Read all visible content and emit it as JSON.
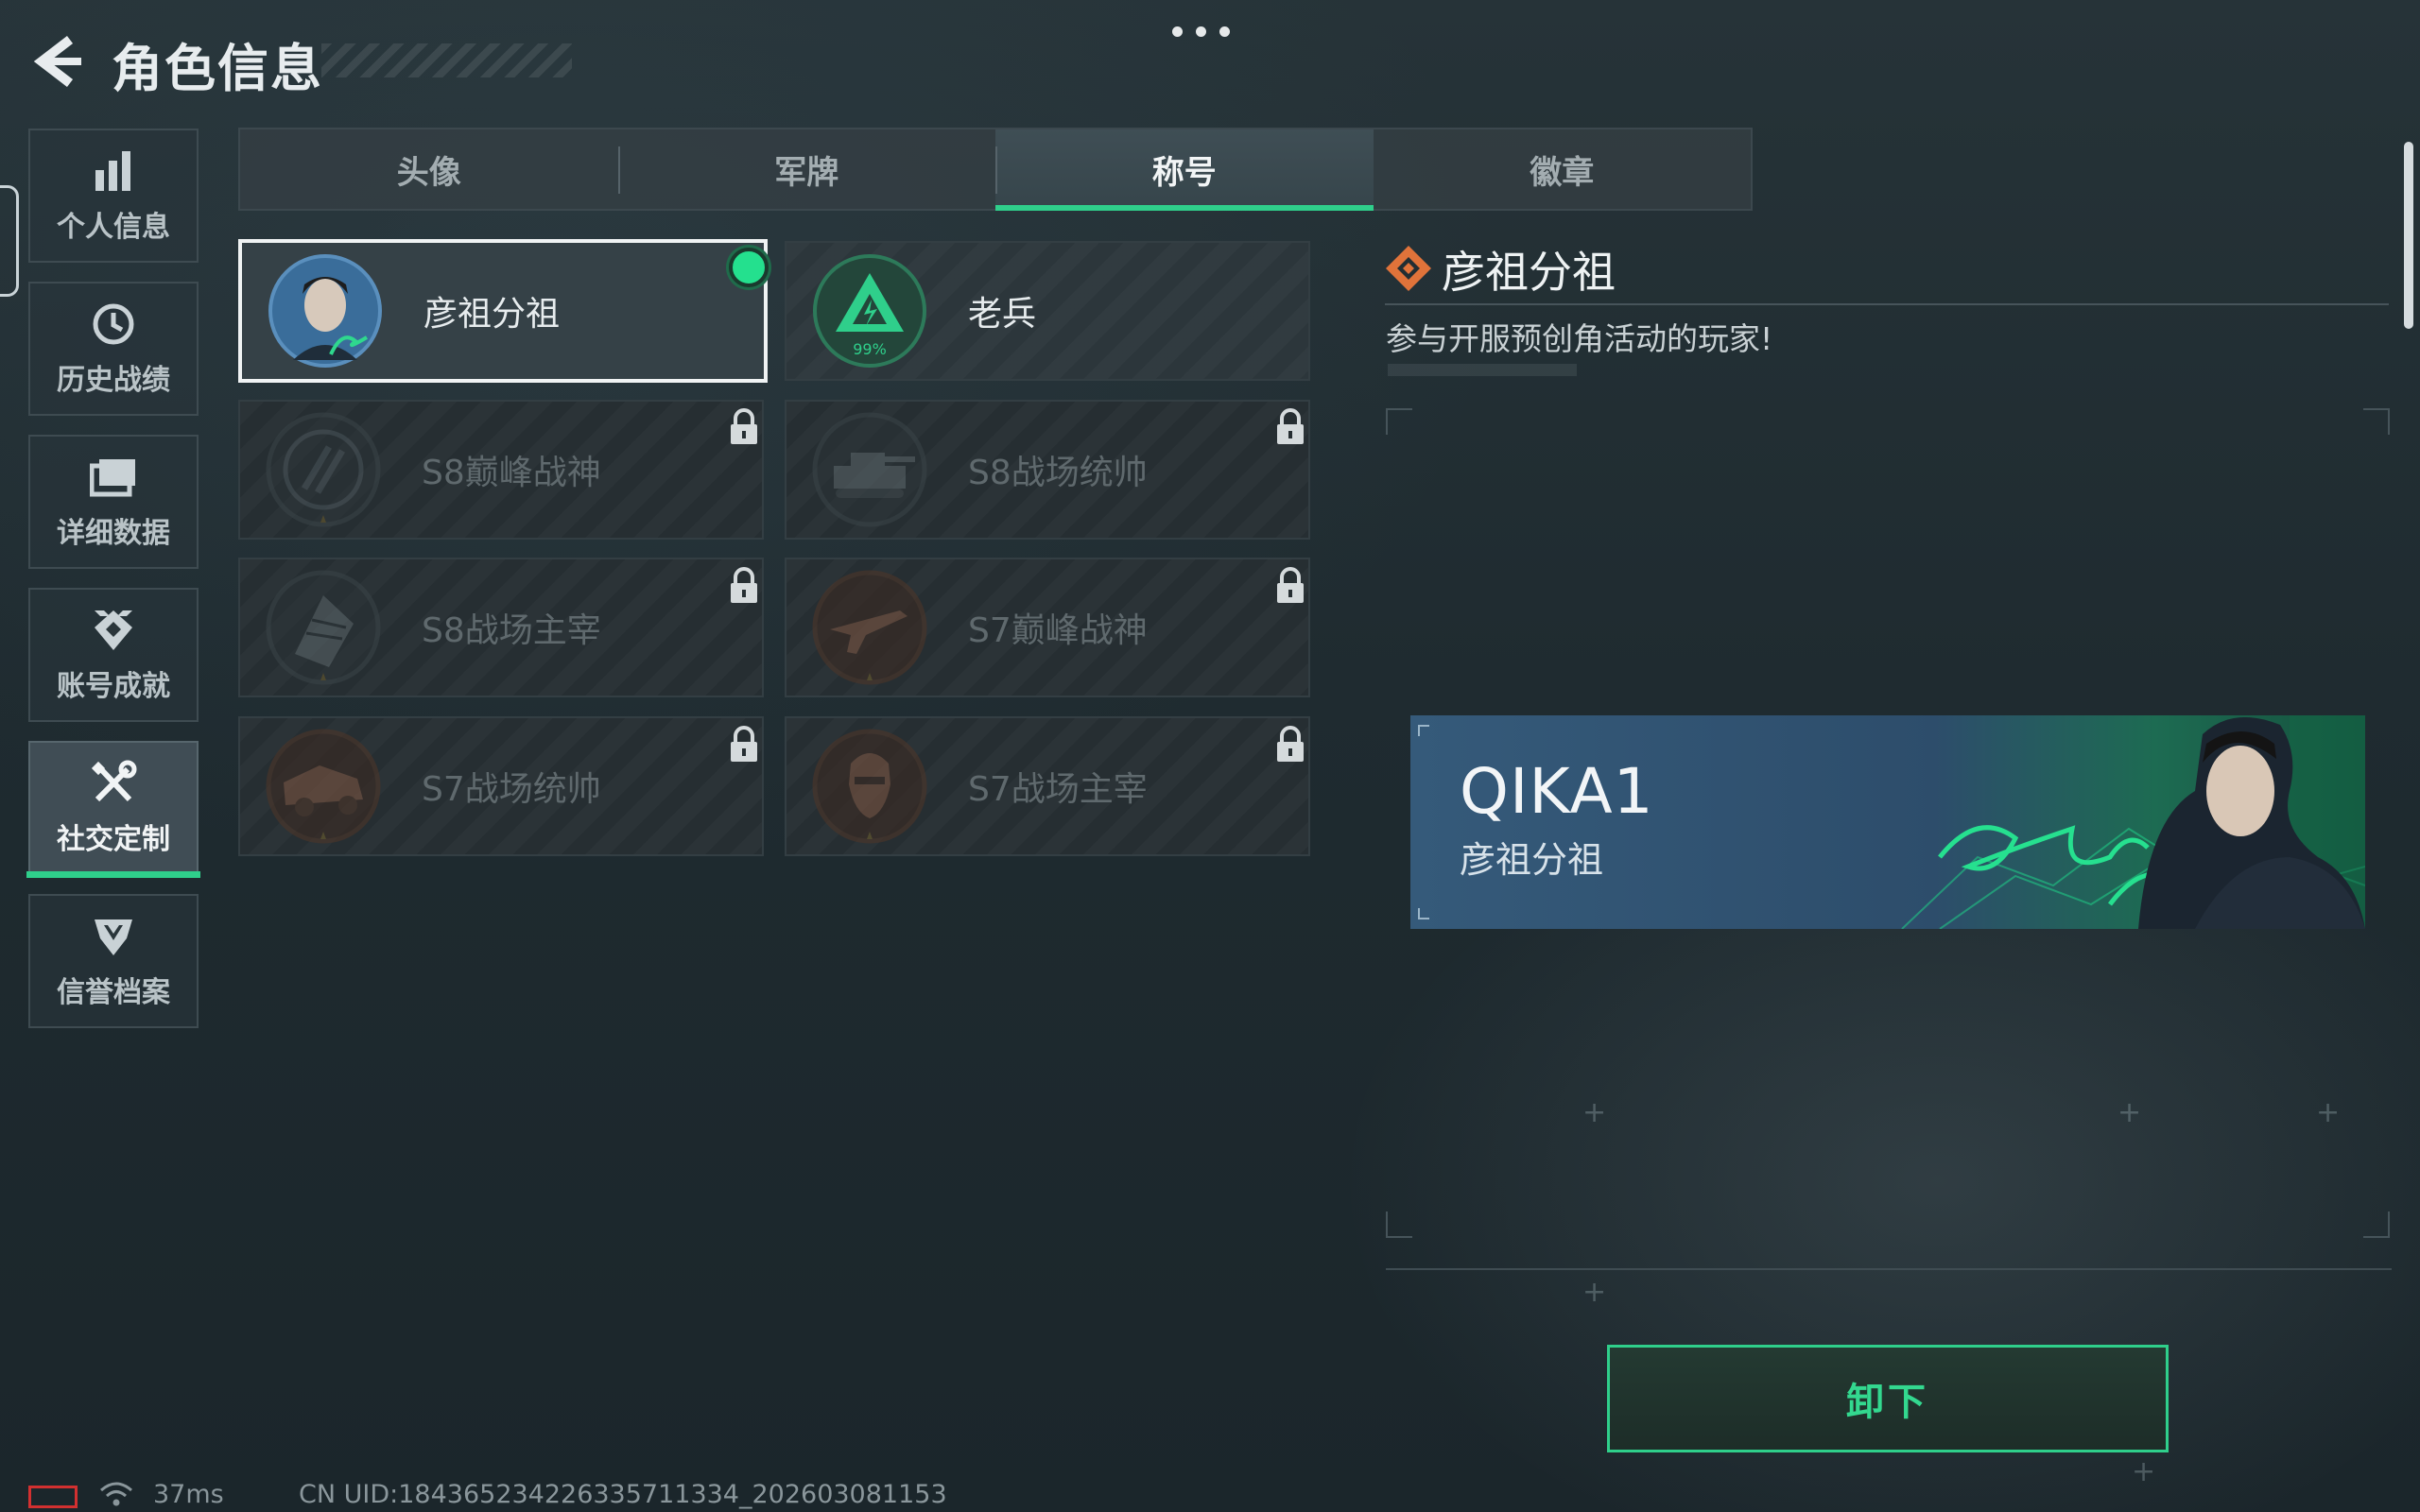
{
  "header": {
    "title": "角色信息",
    "back_icon": "chevron-left-icon",
    "more_icon": "more-dots-icon"
  },
  "sidebar": {
    "items": [
      {
        "label": "个人信息",
        "icon": "bar-chart-icon",
        "active": false
      },
      {
        "label": "历史战绩",
        "icon": "history-clock-icon",
        "active": false
      },
      {
        "label": "详细数据",
        "icon": "folder-icon",
        "active": false
      },
      {
        "label": "账号成就",
        "icon": "achievement-badge-icon",
        "active": false
      },
      {
        "label": "社交定制",
        "icon": "tools-icon",
        "active": true
      },
      {
        "label": "信誉档案",
        "icon": "shield-chevron-icon",
        "active": false
      }
    ]
  },
  "tabs": [
    {
      "label": "头像",
      "active": false
    },
    {
      "label": "军牌",
      "active": false
    },
    {
      "label": "称号",
      "active": true
    },
    {
      "label": "徽章",
      "active": false
    }
  ],
  "titles": [
    {
      "name": "彦祖分祖",
      "locked": false,
      "selected": true,
      "equipped": true,
      "emblem": "portrait-signature-emblem-icon"
    },
    {
      "name": "老兵",
      "locked": false,
      "selected": false,
      "equipped": false,
      "emblem": "veteran-triangle-emblem-icon",
      "emblem_text": "99%"
    },
    {
      "name": "S8巅峰战神",
      "locked": true,
      "emblem": "s8-peak-emblem-icon"
    },
    {
      "name": "S8战场统帅",
      "locked": true,
      "emblem": "tank-emblem-icon"
    },
    {
      "name": "S8战场主宰",
      "locked": true,
      "emblem": "building-emblem-icon"
    },
    {
      "name": "S7巅峰战神",
      "locked": true,
      "emblem": "rifle-emblem-icon"
    },
    {
      "name": "S7战场统帅",
      "locked": true,
      "emblem": "vehicle-emblem-icon"
    },
    {
      "name": "S7战场主宰",
      "locked": true,
      "emblem": "soldier-emblem-icon"
    }
  ],
  "detail": {
    "title": "彦祖分祖",
    "description": "参与开服预创角活动的玩家!",
    "banner": {
      "player_name": "QIKA1",
      "title": "彦祖分祖"
    },
    "unequip_label": "卸下"
  },
  "status_bar": {
    "ping": "37ms",
    "uid": "CN UID:18436523422633571133​4_202603081153"
  },
  "colors": {
    "accent": "#2fcf8b",
    "background": "#222e33",
    "title_icon": "#e0733a",
    "battery": "#d23030"
  }
}
